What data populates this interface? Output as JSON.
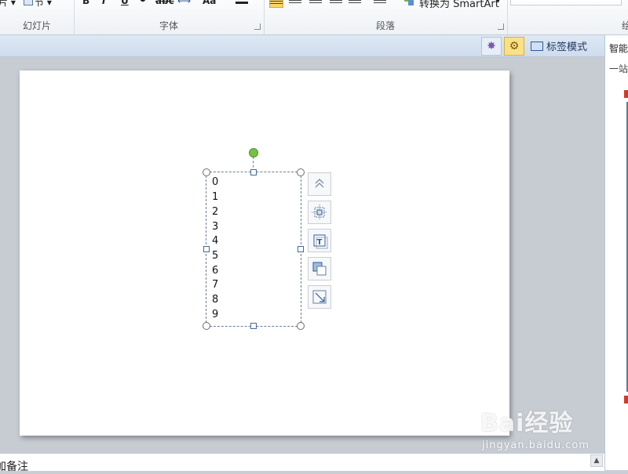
{
  "ribbon": {
    "groups": {
      "slides": {
        "label": "幻灯片",
        "new_slide_tail": "片",
        "section_label": "节"
      },
      "font": {
        "label": "字体",
        "bold": "B",
        "italic": "I",
        "underline": "U",
        "strike": "abc",
        "change_case": "Aa"
      },
      "paragraph": {
        "label": "段落",
        "smartart_label": "转换为 SmartArt"
      },
      "drawing": {
        "label": "绘"
      }
    }
  },
  "toolbar_strip": {
    "tag_mode_label": "标签模式"
  },
  "slide": {
    "textbox_lines": [
      "0",
      "1",
      "2",
      "3",
      "4",
      "5",
      "6",
      "7",
      "8",
      "9"
    ]
  },
  "right_pane": {
    "title": "智能",
    "subtitle": "一站"
  },
  "notes": {
    "placeholder": "加备注"
  },
  "watermark": {
    "brand": "Bai经验",
    "url": "jingyan.baidu.com"
  },
  "colors": {
    "accent_selected": "#fbd56a",
    "rotate_handle": "#76c043",
    "strip": "#dde8f4"
  }
}
